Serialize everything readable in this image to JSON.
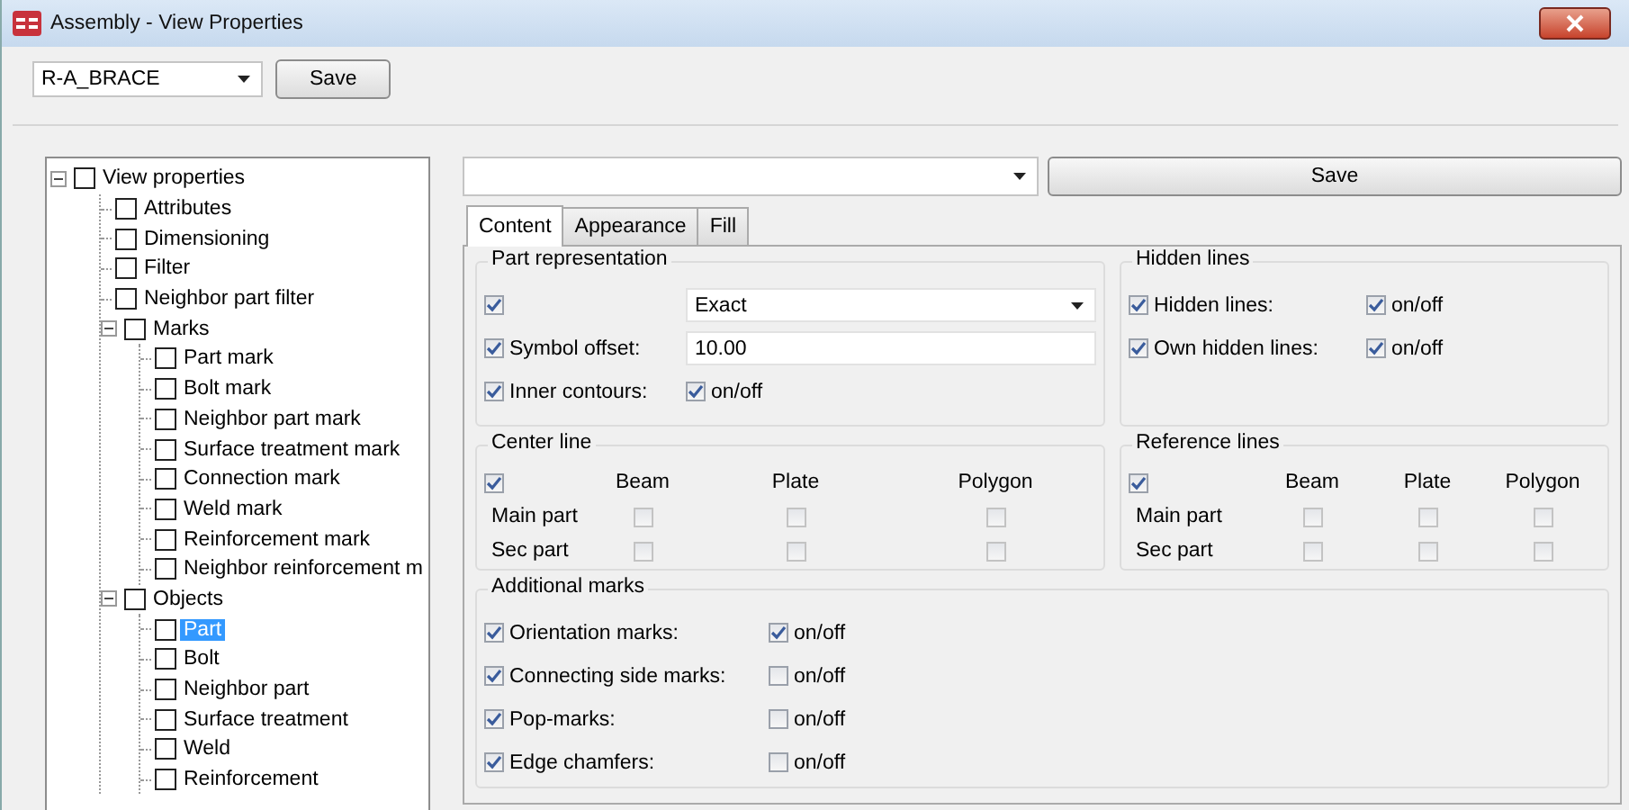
{
  "window": {
    "title": "Assembly - View Properties"
  },
  "toolbar": {
    "preset": "R-A_BRACE",
    "save_button": "Save"
  },
  "tree": [
    {
      "label": "View properties",
      "checked": false,
      "expanded": true,
      "selected": false,
      "children": [
        {
          "label": "Attributes",
          "checked": false,
          "selected": false
        },
        {
          "label": "Dimensioning",
          "checked": false,
          "selected": false
        },
        {
          "label": "Filter",
          "checked": false,
          "selected": false
        },
        {
          "label": "Neighbor part filter",
          "checked": false,
          "selected": false
        },
        {
          "label": "Marks",
          "checked": false,
          "expanded": true,
          "selected": false,
          "children": [
            {
              "label": "Part mark",
              "checked": false,
              "selected": false
            },
            {
              "label": "Bolt mark",
              "checked": false,
              "selected": false
            },
            {
              "label": "Neighbor part mark",
              "checked": false,
              "selected": false
            },
            {
              "label": "Surface treatment mark",
              "checked": false,
              "selected": false
            },
            {
              "label": "Connection mark",
              "checked": false,
              "selected": false
            },
            {
              "label": "Weld mark",
              "checked": false,
              "selected": false
            },
            {
              "label": "Reinforcement mark",
              "checked": false,
              "selected": false
            },
            {
              "label": "Neighbor reinforcement m",
              "checked": false,
              "selected": false
            }
          ]
        },
        {
          "label": "Objects",
          "checked": false,
          "expanded": true,
          "selected": false,
          "children": [
            {
              "label": "Part",
              "checked": false,
              "selected": true
            },
            {
              "label": "Bolt",
              "checked": false,
              "selected": false
            },
            {
              "label": "Neighbor part",
              "checked": false,
              "selected": false
            },
            {
              "label": "Surface treatment",
              "checked": false,
              "selected": false
            },
            {
              "label": "Weld",
              "checked": false,
              "selected": false
            },
            {
              "label": "Reinforcement",
              "checked": false,
              "selected": false
            }
          ]
        }
      ]
    }
  ],
  "panel": {
    "save_button": "Save"
  },
  "tabs": [
    {
      "label": "Content",
      "selected": true
    },
    {
      "label": "Appearance",
      "selected": false
    },
    {
      "label": "Fill",
      "selected": false
    }
  ],
  "part_representation": {
    "title": "Part representation",
    "rows": [
      {
        "kind": "combo",
        "checked": true,
        "value": "Exact"
      },
      {
        "kind": "text",
        "checked": true,
        "label": "Symbol offset:",
        "value": "10.00"
      },
      {
        "kind": "toggle",
        "checked": true,
        "label": "Inner contours:",
        "on": true,
        "toggle_label": "on/off"
      }
    ]
  },
  "hidden_lines": {
    "title": "Hidden lines",
    "rows": [
      {
        "kind": "toggle",
        "checked": true,
        "label": "Hidden lines:",
        "on": true,
        "toggle_label": "on/off"
      },
      {
        "kind": "toggle",
        "checked": true,
        "label": "Own hidden lines:",
        "on": true,
        "toggle_label": "on/off"
      }
    ]
  },
  "center_line": {
    "title": "Center line",
    "checked": true,
    "columns": [
      "Beam",
      "Plate",
      "Polygon"
    ],
    "rows": [
      {
        "label": "Main part",
        "checks": [
          false,
          false,
          false
        ]
      },
      {
        "label": "Sec part",
        "checks": [
          false,
          false,
          false
        ]
      }
    ]
  },
  "reference_lines": {
    "title": "Reference lines",
    "checked": true,
    "columns": [
      "Beam",
      "Plate",
      "Polygon"
    ],
    "rows": [
      {
        "label": "Main part",
        "checks": [
          false,
          false,
          false
        ]
      },
      {
        "label": "Sec part",
        "checks": [
          false,
          false,
          false
        ]
      }
    ]
  },
  "additional_marks": {
    "title": "Additional marks",
    "rows": [
      {
        "kind": "toggle",
        "checked": true,
        "label": "Orientation marks:",
        "on": true,
        "toggle_label": "on/off"
      },
      {
        "kind": "toggle",
        "checked": true,
        "label": "Connecting side marks:",
        "on": false,
        "toggle_label": "on/off"
      },
      {
        "kind": "toggle",
        "checked": true,
        "label": "Pop-marks:",
        "on": false,
        "toggle_label": "on/off"
      },
      {
        "kind": "toggle",
        "checked": true,
        "label": "Edge chamfers:",
        "on": false,
        "toggle_label": "on/off"
      }
    ]
  }
}
